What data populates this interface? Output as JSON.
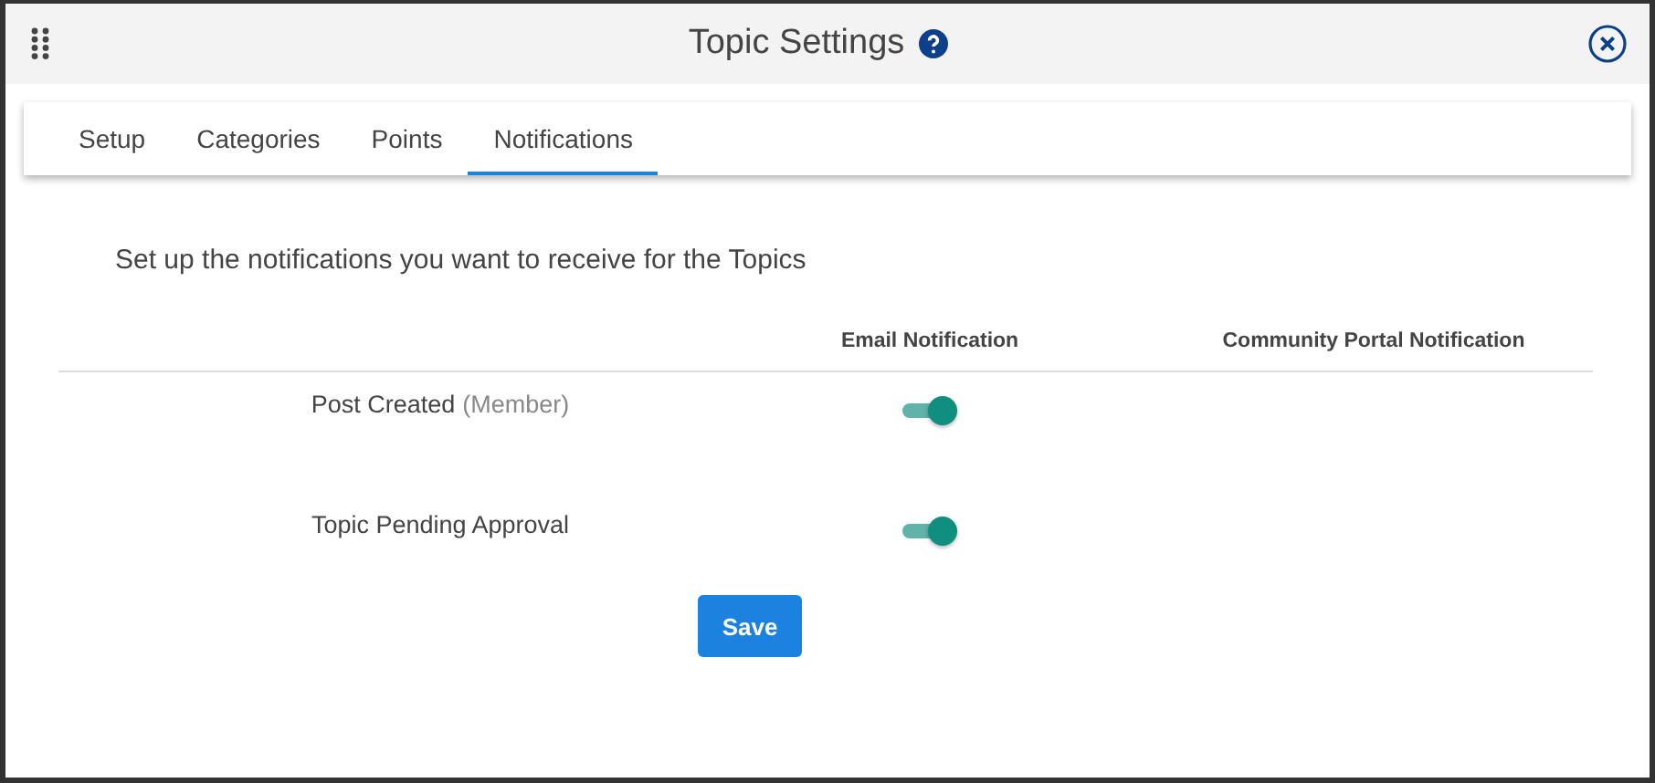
{
  "window": {
    "title": "Topic Settings"
  },
  "tabs": [
    {
      "label": "Setup",
      "selected": false
    },
    {
      "label": "Categories",
      "selected": false
    },
    {
      "label": "Points",
      "selected": false
    },
    {
      "label": "Notifications",
      "selected": true
    }
  ],
  "intro": "Set up the notifications you want to receive for the Topics",
  "table": {
    "columns": [
      "Email Notification",
      "Community Portal Notification"
    ],
    "rows": [
      {
        "label": "Post Created",
        "note": "(Member)",
        "email_on": true
      },
      {
        "label": "Topic Pending Approval",
        "email_on": true
      }
    ]
  },
  "buttons": [
    "Save"
  ]
}
